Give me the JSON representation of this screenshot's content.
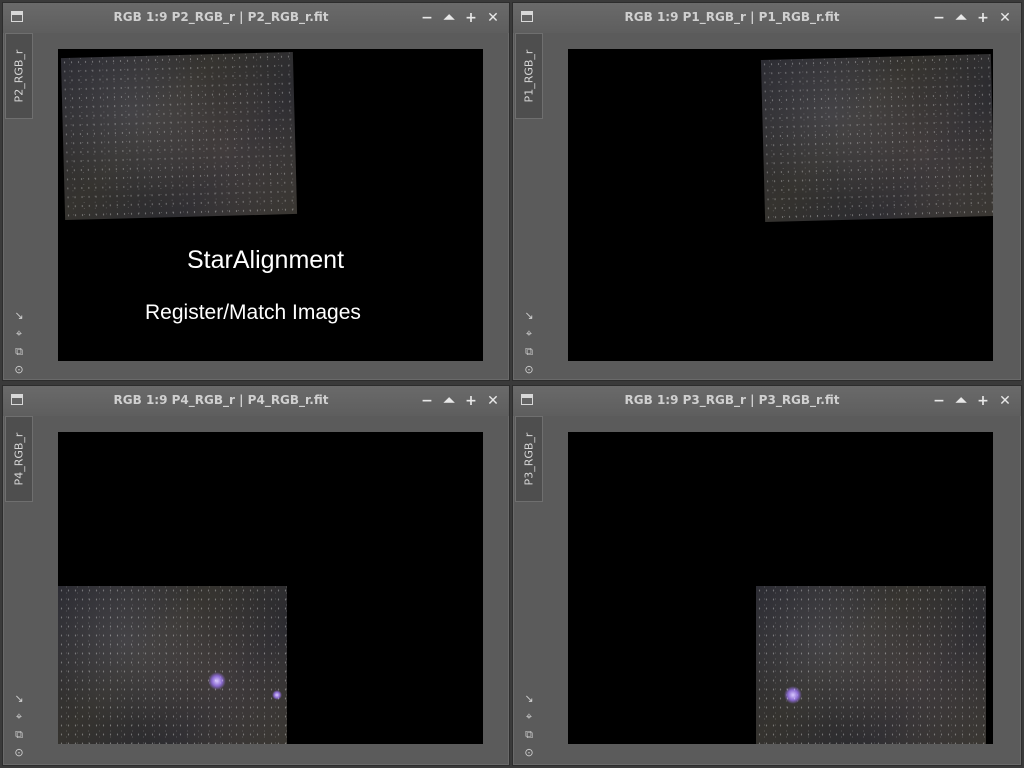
{
  "windows": [
    {
      "title": "RGB 1:9 P2_RGB_r | P2_RGB_r.fit",
      "tab": "P2_RGB_r"
    },
    {
      "title": "RGB 1:9 P1_RGB_r | P1_RGB_r.fit",
      "tab": "P1_RGB_r"
    },
    {
      "title": "RGB 1:9 P4_RGB_r | P4_RGB_r.fit",
      "tab": "P4_RGB_r"
    },
    {
      "title": "RGB 1:9 P3_RGB_r | P3_RGB_r.fit",
      "tab": "P3_RGB_r"
    }
  ],
  "controls": {
    "minimize": "−",
    "shade": "⏶",
    "maximize": "+",
    "close": "✕"
  },
  "side_icons": [
    "↘",
    "⌖",
    "⧉",
    "⊙"
  ],
  "overlay": {
    "heading": "StarAlignment",
    "subheading": "Register/Match Images"
  },
  "colors": {
    "window_bg": "#5b5b5b",
    "viewport_bg": "#000000",
    "title_text": "#d0d0d0"
  }
}
